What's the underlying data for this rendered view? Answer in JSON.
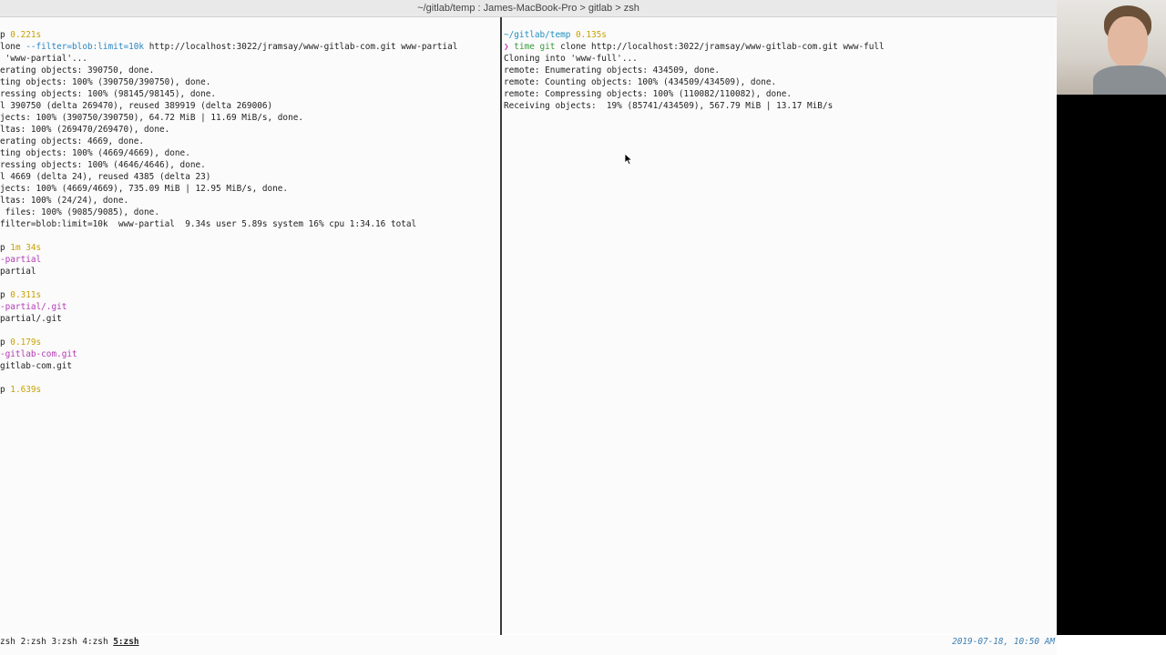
{
  "window": {
    "title": "~/gitlab/temp : James-MacBook-Pro > gitlab > zsh"
  },
  "left_pane": {
    "lines": [
      [
        {
          "t": "p ",
          "c": ""
        },
        {
          "t": "0.221s",
          "c": "c-time"
        }
      ],
      [
        {
          "t": "lone ",
          "c": ""
        },
        {
          "t": "--filter=blob:limit=10k",
          "c": "c-opt"
        },
        {
          "t": " http://localhost:3022/jramsay/www-gitlab-com.git www-partial",
          "c": ""
        }
      ],
      [
        {
          "t": " 'www-partial'...",
          "c": ""
        }
      ],
      [
        {
          "t": "erating objects: 390750, done.",
          "c": ""
        }
      ],
      [
        {
          "t": "ting objects: 100% (390750/390750), done.",
          "c": ""
        }
      ],
      [
        {
          "t": "ressing objects: 100% (98145/98145), done.",
          "c": ""
        }
      ],
      [
        {
          "t": "l 390750 (delta 269470), reused 389919 (delta 269006)",
          "c": ""
        }
      ],
      [
        {
          "t": "jects: 100% (390750/390750), 64.72 MiB | 11.69 MiB/s, done.",
          "c": ""
        }
      ],
      [
        {
          "t": "ltas: 100% (269470/269470), done.",
          "c": ""
        }
      ],
      [
        {
          "t": "erating objects: 4669, done.",
          "c": ""
        }
      ],
      [
        {
          "t": "ting objects: 100% (4669/4669), done.",
          "c": ""
        }
      ],
      [
        {
          "t": "ressing objects: 100% (4646/4646), done.",
          "c": ""
        }
      ],
      [
        {
          "t": "l 4669 (delta 24), reused 4385 (delta 23)",
          "c": ""
        }
      ],
      [
        {
          "t": "jects: 100% (4669/4669), 735.09 MiB | 12.95 MiB/s, done.",
          "c": ""
        }
      ],
      [
        {
          "t": "ltas: 100% (24/24), done.",
          "c": ""
        }
      ],
      [
        {
          "t": " files: 100% (9085/9085), done.",
          "c": ""
        }
      ],
      [
        {
          "t": "filter=blob:limit=10k  www-partial  9.34s user 5.89s system 16% cpu 1:34.16 total",
          "c": ""
        }
      ],
      [],
      [
        {
          "t": "p ",
          "c": ""
        },
        {
          "t": "1m 34s",
          "c": "c-time"
        }
      ],
      [
        {
          "t": "-partial",
          "c": "c-branch"
        }
      ],
      [
        {
          "t": "partial",
          "c": ""
        }
      ],
      [],
      [
        {
          "t": "p ",
          "c": ""
        },
        {
          "t": "0.311s",
          "c": "c-time"
        }
      ],
      [
        {
          "t": "-partial/.git",
          "c": "c-branch"
        }
      ],
      [
        {
          "t": "partial/.git",
          "c": ""
        }
      ],
      [],
      [
        {
          "t": "p ",
          "c": ""
        },
        {
          "t": "0.179s",
          "c": "c-time"
        }
      ],
      [
        {
          "t": "-gitlab-com.git",
          "c": "c-branch"
        }
      ],
      [
        {
          "t": "gitlab-com.git",
          "c": ""
        }
      ],
      [],
      [
        {
          "t": "p ",
          "c": ""
        },
        {
          "t": "1.639s",
          "c": "c-time"
        }
      ]
    ]
  },
  "right_pane": {
    "lines": [
      [
        {
          "t": "~/gitlab/temp",
          "c": "c-dir"
        },
        {
          "t": " ",
          "c": ""
        },
        {
          "t": "0.135s",
          "c": "c-time"
        }
      ],
      [
        {
          "t": "❯ ",
          "c": "c-arrow"
        },
        {
          "t": "time git",
          "c": "c-cmd"
        },
        {
          "t": " clone http://localhost:3022/jramsay/www-gitlab-com.git www-full",
          "c": ""
        }
      ],
      [
        {
          "t": "Cloning into 'www-full'...",
          "c": ""
        }
      ],
      [
        {
          "t": "remote: Enumerating objects: 434509, done.",
          "c": ""
        }
      ],
      [
        {
          "t": "remote: Counting objects: 100% (434509/434509), done.",
          "c": ""
        }
      ],
      [
        {
          "t": "remote: Compressing objects: 100% (110082/110082), done.",
          "c": ""
        }
      ],
      [
        {
          "t": "Receiving objects:  19% (85741/434509), 567.79 MiB | 13.17 MiB/s",
          "c": ""
        }
      ]
    ]
  },
  "status_bar": {
    "tabs": [
      "zsh",
      "2:zsh",
      "3:zsh",
      "4:zsh",
      "5:zsh"
    ],
    "active_tab": "5:zsh",
    "datetime": "2019-07-18, 10:50 AM"
  },
  "icons": {
    "cursor": "mouse-pointer-icon"
  }
}
